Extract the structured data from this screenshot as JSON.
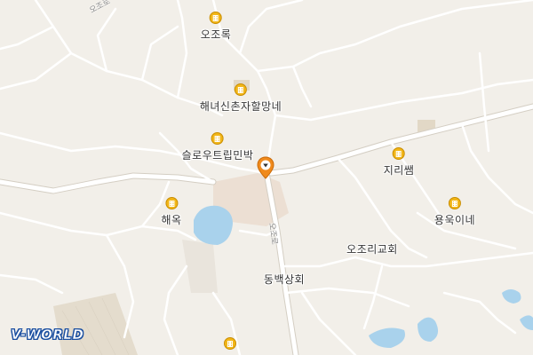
{
  "map": {
    "pois": [
      {
        "name": "오조록",
        "icon": "building-icon"
      },
      {
        "name": "해녀신촌자할망네",
        "icon": "building-icon"
      },
      {
        "name": "슬로우트립민박",
        "icon": "building-icon"
      },
      {
        "name": "지리쌤",
        "icon": "building-icon"
      },
      {
        "name": "해옥",
        "icon": "building-icon"
      },
      {
        "name": "용욱이네",
        "icon": "building-icon"
      },
      {
        "name": "",
        "icon": "building-icon"
      }
    ],
    "places": [
      "오조리교회",
      "동백상회"
    ],
    "roads": [
      "오조로",
      "오조로"
    ],
    "marker": {
      "icon": "location-pin-icon",
      "color": "#f08a1c"
    },
    "colors": {
      "background": "#f2efe9",
      "road": "#ffffff",
      "road_casing": "#d4cec3",
      "water": "#a9d2ec",
      "poi": "#f2b618",
      "building": "#e2d8c6"
    }
  },
  "logo": {
    "text": "V-WORLD",
    "color": "#1b4fa0"
  }
}
